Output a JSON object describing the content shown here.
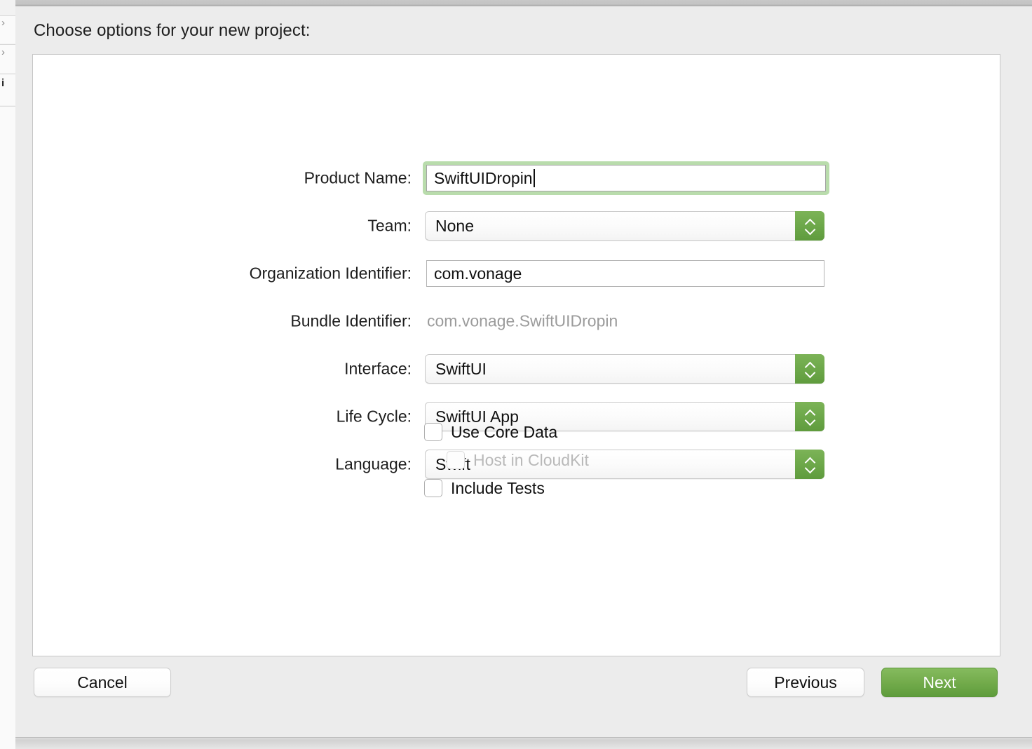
{
  "dialog": {
    "title": "Choose options for your new project:"
  },
  "background_window": {
    "glyph_top": "›",
    "glyph_mid": "›",
    "glyph_low": "i"
  },
  "form": {
    "rows": [
      {
        "label": "Product Name:",
        "type": "textfield",
        "value": "SwiftUIDropin",
        "placeholder": "",
        "focused": true,
        "name": "product-name"
      },
      {
        "label": "Team:",
        "type": "popup",
        "value": "None",
        "name": "team"
      },
      {
        "label": "Organization Identifier:",
        "type": "textfield-plain",
        "value": "com.vonage",
        "placeholder": "",
        "name": "organization-identifier"
      },
      {
        "label": "Bundle Identifier:",
        "type": "static",
        "value": "com.vonage.SwiftUIDropin",
        "name": "bundle-identifier"
      },
      {
        "label": "Interface:",
        "type": "popup",
        "value": "SwiftUI",
        "name": "interface"
      },
      {
        "label": "Life Cycle:",
        "type": "popup",
        "value": "SwiftUI App",
        "name": "life-cycle"
      },
      {
        "label": "Language:",
        "type": "popup",
        "value": "Swift",
        "name": "language"
      }
    ],
    "checkboxes": [
      {
        "label": "Use Core Data",
        "checked": false,
        "disabled": false,
        "indented": false,
        "name": "use-core-data"
      },
      {
        "label": "Host in CloudKit",
        "checked": false,
        "disabled": true,
        "indented": true,
        "name": "host-in-cloudkit"
      },
      {
        "label": "Include Tests",
        "checked": false,
        "disabled": false,
        "indented": false,
        "name": "include-tests"
      }
    ]
  },
  "footer": {
    "cancel_label": "Cancel",
    "previous_label": "Previous",
    "next_label": "Next"
  },
  "colors": {
    "accent_green": "#6da84a",
    "focus_ring": "#b9dcac",
    "default_button_top": "#85bb5f",
    "default_button_bottom": "#5e9c3c",
    "dialog_background": "#ececec",
    "panel_background": "#ffffff",
    "disabled_text": "#b9b9b9",
    "static_text": "#9b9b9b"
  }
}
